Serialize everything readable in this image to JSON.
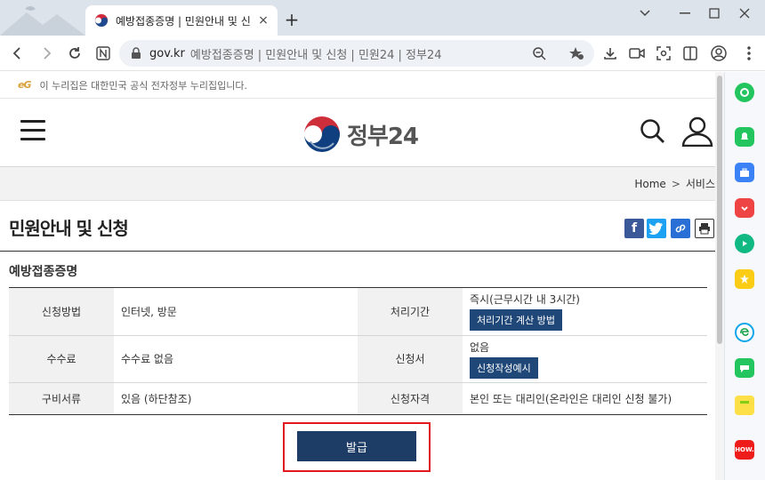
{
  "browser": {
    "tab_title": "예방접종증명 | 민원안내 및 신청",
    "tab_close": "×",
    "new_tab": "+",
    "url_domain": "gov.kr",
    "url_rest": "예방접종증명 | 민원안내 및 신청 | 민원24 | 정부24"
  },
  "notice": {
    "mark": "eG",
    "text": "이 누리집은 대한민국 공식 전자정부 누리집입니다."
  },
  "header": {
    "logo_text": "정부24"
  },
  "breadcrumb": {
    "home": "Home",
    "sep": ">",
    "current": "서비스"
  },
  "page": {
    "title": "민원안내 및 신청",
    "subtitle": "예방접종증명"
  },
  "table": {
    "rows": [
      {
        "label1": "신청방법",
        "value1": "인터넷, 방문",
        "label2": "처리기간",
        "value2": "즉시(근무시간 내 3시간)",
        "button2": "처리기간 계산 방법"
      },
      {
        "label1": "수수료",
        "value1": "수수료 없음",
        "label2": "신청서",
        "value2": "없음",
        "button2": "신청작성예시"
      },
      {
        "label1": "구비서류",
        "value1": "있음 (하단참조)",
        "label2": "신청자격",
        "value2": "본인 또는 대리인(온라인은 대리인 신청 불가)"
      }
    ]
  },
  "actions": {
    "issue_label": "발급"
  },
  "sidepanel": {
    "how_label": "HOW."
  },
  "colors": {
    "primary_button": "#1d3d66",
    "highlight": "#e0181f"
  }
}
